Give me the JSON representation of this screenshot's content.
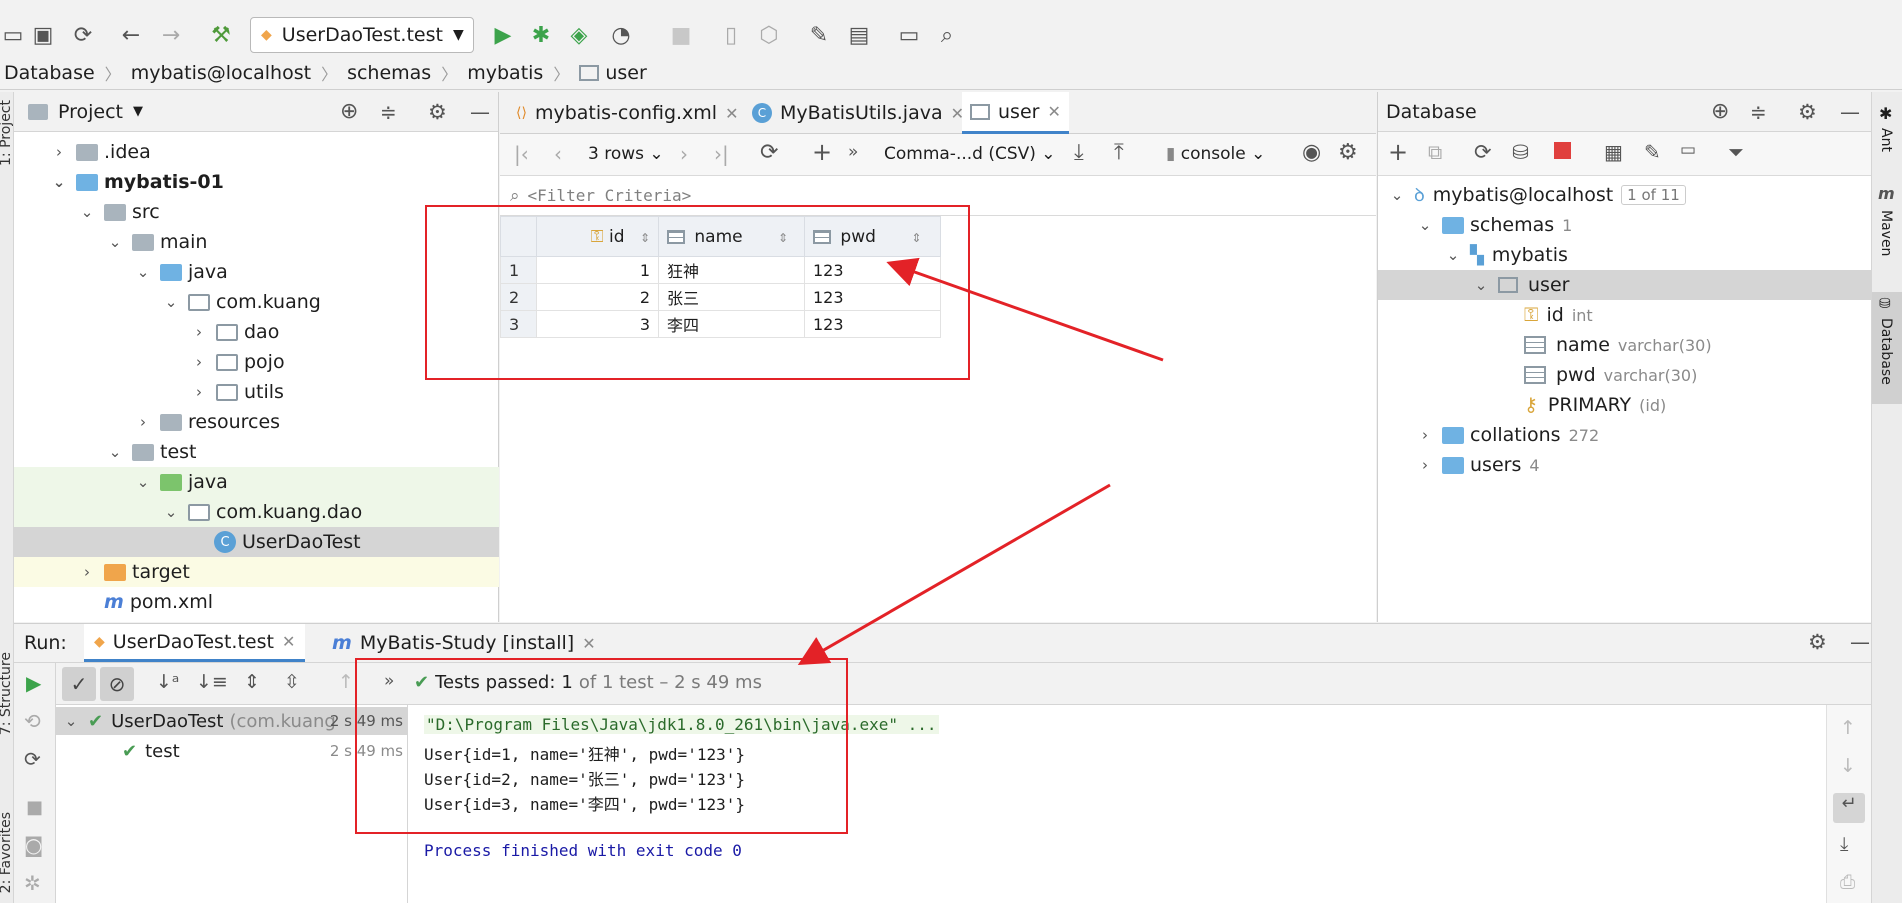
{
  "toolbar": {
    "run_config": "UserDaoTest.test",
    "icons": [
      "open-icon",
      "save-icon",
      "sync-icon",
      "back-icon",
      "forward-icon",
      "build-icon",
      "run-icon",
      "debug-icon",
      "coverage-icon",
      "profile-icon",
      "stop-icon",
      "device-icon",
      "sdk-icon",
      "settings-icon",
      "project-structure-icon",
      "terminal-icon",
      "search-icon"
    ]
  },
  "breadcrumb": [
    "Database",
    "mybatis@localhost",
    "schemas",
    "mybatis",
    "user"
  ],
  "project": {
    "title": "Project",
    "tree": [
      {
        "label": ".idea",
        "depth": 1
      },
      {
        "label": "mybatis-01",
        "depth": 1
      },
      {
        "label": "src",
        "depth": 2
      },
      {
        "label": "main",
        "depth": 3
      },
      {
        "label": "java",
        "depth": 4
      },
      {
        "label": "com.kuang",
        "depth": 5
      },
      {
        "label": "dao",
        "depth": 6
      },
      {
        "label": "pojo",
        "depth": 6
      },
      {
        "label": "utils",
        "depth": 6
      },
      {
        "label": "resources",
        "depth": 4
      },
      {
        "label": "test",
        "depth": 3
      },
      {
        "label": "java",
        "depth": 4
      },
      {
        "label": "com.kuang.dao",
        "depth": 5
      },
      {
        "label": "UserDaoTest",
        "depth": 6
      },
      {
        "label": "target",
        "depth": 2
      },
      {
        "label": "pom.xml",
        "depth": 2
      }
    ]
  },
  "editor": {
    "tabs": [
      "mybatis-config.xml",
      "MyBatisUtils.java",
      "user"
    ],
    "rows_label": "3 rows",
    "export_format": "Comma-...d (CSV)",
    "console_label": "console",
    "filter_placeholder": "<Filter Criteria>",
    "columns": [
      "id",
      "name",
      "pwd"
    ],
    "rows": [
      {
        "num": "1",
        "id": "1",
        "name": "狂神",
        "pwd": "123"
      },
      {
        "num": "2",
        "id": "2",
        "name": "张三",
        "pwd": "123"
      },
      {
        "num": "3",
        "id": "3",
        "name": "李四",
        "pwd": "123"
      }
    ]
  },
  "database": {
    "title": "Database",
    "connection": "mybatis@localhost",
    "connection_badge": "1 of 11",
    "schemas": "schemas",
    "schemas_count": "1",
    "schema_name": "mybatis",
    "table": "user",
    "columns": [
      {
        "name": "id",
        "type": "int"
      },
      {
        "name": "name",
        "type": "varchar(30)"
      },
      {
        "name": "pwd",
        "type": "varchar(30)"
      }
    ],
    "key": "PRIMARY",
    "key_cols": "(id)",
    "collations": "collations",
    "collations_count": "272",
    "users": "users",
    "users_count": "4"
  },
  "side": {
    "left_top": "1: Project",
    "left_mid": "7: Structure",
    "left_bottom": "2: Favorites",
    "right_ant": "Ant",
    "right_maven": "Maven",
    "right_db": "Database"
  },
  "run": {
    "label": "Run:",
    "tabs": [
      "UserDaoTest.test",
      "MyBatis-Study [install]"
    ],
    "status_prefix": "Tests passed:",
    "status_count": "1",
    "status_suffix": "of 1 test – 2 s 49 ms",
    "tree": [
      {
        "label": "UserDaoTest",
        "detail": "(com.kuang",
        "time": "2 s 49 ms"
      },
      {
        "label": "test",
        "time": "2 s 49 ms"
      }
    ],
    "console": [
      "\"D:\\Program Files\\Java\\jdk1.8.0_261\\bin\\java.exe\" ...",
      "User{id=1, name='狂神', pwd='123'}",
      "User{id=2, name='张三', pwd='123'}",
      "User{id=3, name='李四', pwd='123'}",
      "",
      "Process finished with exit code 0"
    ]
  }
}
